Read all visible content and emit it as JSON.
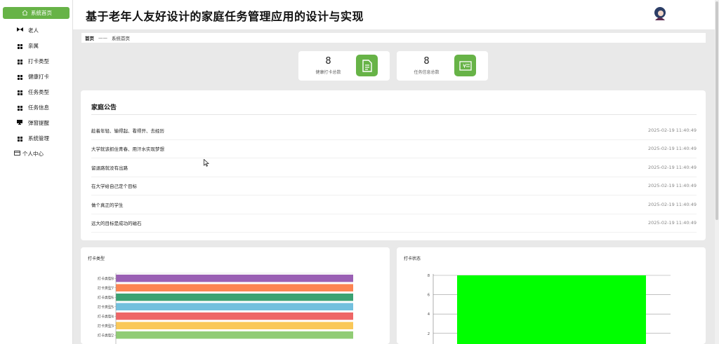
{
  "app": {
    "title": "基于老年人友好设计的家庭任务管理应用的设计与实现"
  },
  "sidebar": {
    "items": [
      {
        "label": "系统首页",
        "icon": "home-icon",
        "active": true
      },
      {
        "label": "老人",
        "icon": "elder-icon"
      },
      {
        "label": "亲属",
        "icon": "grid-icon"
      },
      {
        "label": "打卡类型",
        "icon": "grid-icon"
      },
      {
        "label": "健康打卡",
        "icon": "grid-icon"
      },
      {
        "label": "任务类型",
        "icon": "grid-icon"
      },
      {
        "label": "任务信息",
        "icon": "grid-icon"
      },
      {
        "label": "弹窗提醒",
        "icon": "monitor-icon"
      },
      {
        "label": "系统管理",
        "icon": "grid-icon"
      },
      {
        "label": "个人中心",
        "icon": "id-card-icon"
      }
    ]
  },
  "breadcrumb": {
    "root": "首页",
    "separator": "——",
    "current": "系统首页"
  },
  "stats": [
    {
      "value": "8",
      "label": "健康打卡总数",
      "icon": "document-icon"
    },
    {
      "value": "8",
      "label": "任务信息总数",
      "icon": "money-bill-icon"
    }
  ],
  "notice": {
    "title": "家庭公告",
    "rows": [
      {
        "text": "趁着年轻、输得起、看得开、去经历",
        "time": "2025-02-19 11:40:49"
      },
      {
        "text": "大学就该抓住青春、用汗水实现梦想",
        "time": "2025-02-19 11:40:49"
      },
      {
        "text": "留退路就没有出路",
        "time": "2025-02-19 11:40:49"
      },
      {
        "text": "在大学给自己定个目标",
        "time": "2025-02-19 11:40:49"
      },
      {
        "text": "做个真正的学生",
        "time": "2025-02-19 11:40:49"
      },
      {
        "text": "远大的目标是成功的磁石",
        "time": "2025-02-19 11:40:49"
      }
    ]
  },
  "colors": {
    "accent": "#67b347",
    "status_bar": "#00ff00"
  },
  "chart_data": [
    {
      "type": "bar",
      "orientation": "horizontal",
      "title": "打卡类型",
      "categories": [
        "打卡类型8",
        "打卡类型7",
        "打卡类型6",
        "打卡类型5",
        "打卡类型4",
        "打卡类型3",
        "打卡类型2"
      ],
      "values": [
        1,
        1,
        1,
        1,
        1,
        1,
        1
      ],
      "colors": [
        "#9a60b4",
        "#fc8452",
        "#3ba272",
        "#73c0de",
        "#ee6666",
        "#fac858",
        "#91cc75"
      ],
      "xlim": [
        0,
        1
      ],
      "grid": false
    },
    {
      "type": "bar",
      "title": "打卡状态",
      "categories": [
        ""
      ],
      "values": [
        8
      ],
      "ylim": [
        0,
        8
      ],
      "yticks": [
        2,
        4,
        6,
        8
      ],
      "color": "#00ff00",
      "grid": true
    }
  ]
}
